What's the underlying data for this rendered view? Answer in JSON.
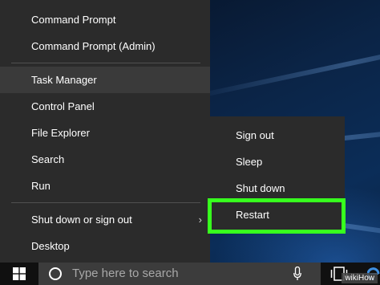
{
  "power_menu": {
    "items": [
      {
        "label": "Command Prompt"
      },
      {
        "label": "Command Prompt (Admin)"
      },
      {
        "label": "Task Manager"
      },
      {
        "label": "Control Panel"
      },
      {
        "label": "File Explorer"
      },
      {
        "label": "Search"
      },
      {
        "label": "Run"
      },
      {
        "label": "Shut down or sign out"
      },
      {
        "label": "Desktop"
      }
    ],
    "submenu_arrow": "›"
  },
  "shutdown_submenu": {
    "items": [
      {
        "label": "Sign out"
      },
      {
        "label": "Sleep"
      },
      {
        "label": "Shut down"
      },
      {
        "label": "Restart"
      }
    ],
    "highlight_color": "#37ff1e"
  },
  "taskbar": {
    "search_placeholder": "Type here to search",
    "icons": [
      "windows-logo-icon",
      "cortana-icon",
      "microphone-icon",
      "task-view-icon",
      "edge-icon"
    ]
  },
  "watermark": "wikiHow"
}
